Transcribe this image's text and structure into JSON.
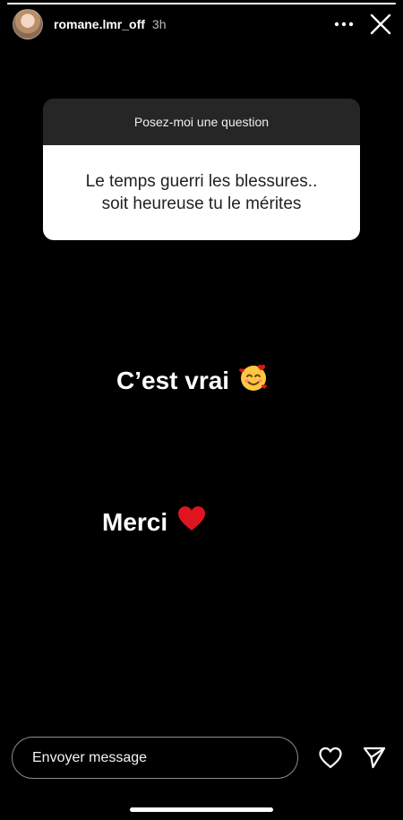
{
  "story": {
    "username": "romane.lmr_off",
    "time": "3h",
    "progress": 1.0
  },
  "question_sticker": {
    "prompt": "Posez-moi une question",
    "answer_line1": "Le temps guerri les blessures..",
    "answer_line2": "soit heureuse tu le mérites"
  },
  "captions": {
    "line1": "C’est vrai",
    "line1_emoji": "smiling-face-with-hearts",
    "line2": "Merci",
    "line2_emoji": "red-heart"
  },
  "reply": {
    "placeholder": "Envoyer message"
  },
  "icons": {
    "more": "more-horizontal-icon",
    "close": "close-icon",
    "like": "heart-outline-icon",
    "send": "send-paper-plane-icon"
  },
  "colors": {
    "background": "#000000",
    "question_header": "#262626",
    "heart_red": "#e0141e"
  }
}
